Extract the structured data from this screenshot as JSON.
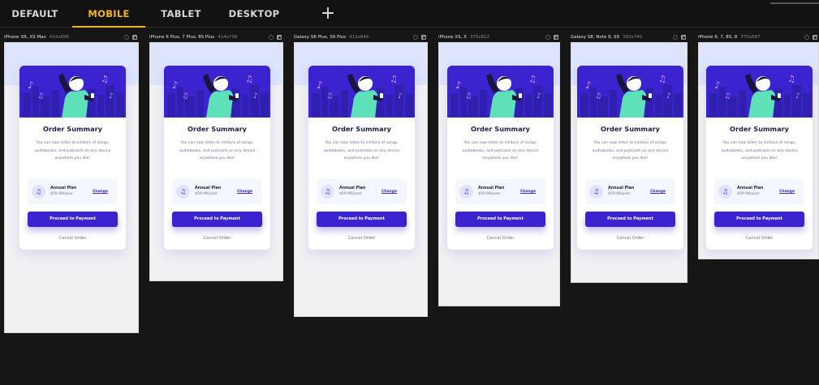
{
  "tabs": [
    {
      "label": "DEFAULT",
      "active": false
    },
    {
      "label": "MOBILE",
      "active": true
    },
    {
      "label": "TABLET",
      "active": false
    },
    {
      "label": "DESKTOP",
      "active": false
    }
  ],
  "add_icon": "plus-icon",
  "accent_color": "#f2b51a",
  "brand_color": "#3b24cf",
  "devices": [
    {
      "name": "iPhone XR, XS Max",
      "size": "414x896"
    },
    {
      "name": "iPhone 6 Plus, 7 Plus, 8S Plus",
      "size": "414x736"
    },
    {
      "name": "Galaxy S8 Plus, S9 Plus",
      "size": "412x846"
    },
    {
      "name": "iPhone XS, X",
      "size": "375x812"
    },
    {
      "name": "Galaxy S8, Note 9, S9",
      "size": "360x740"
    },
    {
      "name": "iPhone 6, 7, 8S, 8",
      "size": "375x667"
    }
  ],
  "card": {
    "title": "Order Summary",
    "description": "You can now listen to millions of songs, audiobooks, and podcasts on any device anywhere you like!",
    "plan_icon": "music-note-icon",
    "plan_name": "Annual Plan",
    "plan_price": "$59.99/year",
    "change_label": "Change",
    "pay_label": "Proceed to Payment",
    "cancel_label": "Cancel Order"
  }
}
